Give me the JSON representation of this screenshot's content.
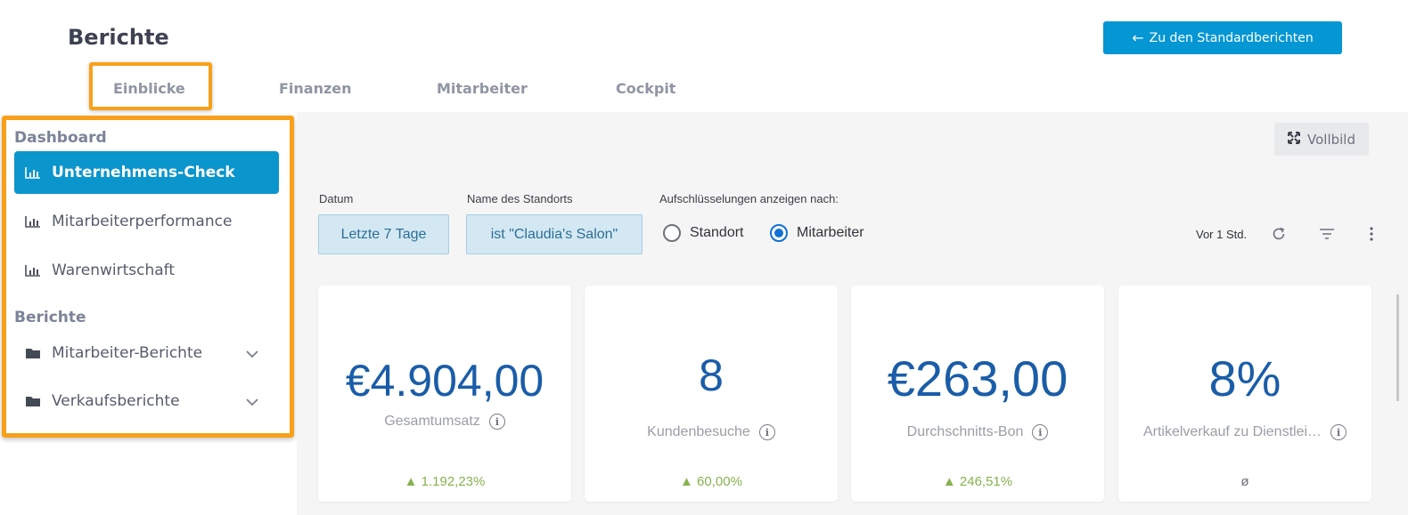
{
  "header": {
    "title": "Berichte",
    "back_button": "Zu den Standardberichten"
  },
  "tabs": [
    {
      "label": "Einblicke",
      "active": true
    },
    {
      "label": "Finanzen"
    },
    {
      "label": "Mitarbeiter"
    },
    {
      "label": "Cockpit"
    }
  ],
  "sidebar": {
    "dashboard_heading": "Dashboard",
    "dashboard_items": [
      {
        "label": "Unternehmens-Check",
        "icon": "bar-chart-icon",
        "active": true
      },
      {
        "label": "Mitarbeiterperformance",
        "icon": "bar-chart-icon"
      },
      {
        "label": "Warenwirtschaft",
        "icon": "bar-chart-icon"
      }
    ],
    "reports_heading": "Berichte",
    "report_folders": [
      {
        "label": "Mitarbeiter-Berichte",
        "icon": "folder-icon"
      },
      {
        "label": "Verkaufsberichte",
        "icon": "folder-icon"
      }
    ]
  },
  "toolbar": {
    "fullscreen": "Vollbild",
    "updated": "Vor 1 Std."
  },
  "filters": {
    "date_label": "Datum",
    "date_value": "Letzte 7 Tage",
    "location_label": "Name des Standorts",
    "location_value": "ist \"Claudia's Salon\"",
    "breakdown_label": "Aufschlüsselungen anzeigen nach:",
    "breakdown_options": [
      {
        "label": "Standort",
        "checked": false
      },
      {
        "label": "Mitarbeiter",
        "checked": true
      }
    ]
  },
  "kpis": [
    {
      "value": "€4.904,00",
      "label": "Gesamtumsatz",
      "change": "▲ 1.192,23%"
    },
    {
      "value": "8",
      "label": "Kundenbesuche",
      "change": "▲ 60,00%"
    },
    {
      "value": "€263,00",
      "label": "Durchschnitts-Bon",
      "change": "▲ 246,51%"
    },
    {
      "value": "8%",
      "label": "Artikelverkauf zu Dienstlei…",
      "change": "ø"
    }
  ],
  "colors": {
    "accent": "#0596d4",
    "highlight": "#f7a11a",
    "kpi_value": "#1a5da8",
    "positive": "#86b24f"
  }
}
